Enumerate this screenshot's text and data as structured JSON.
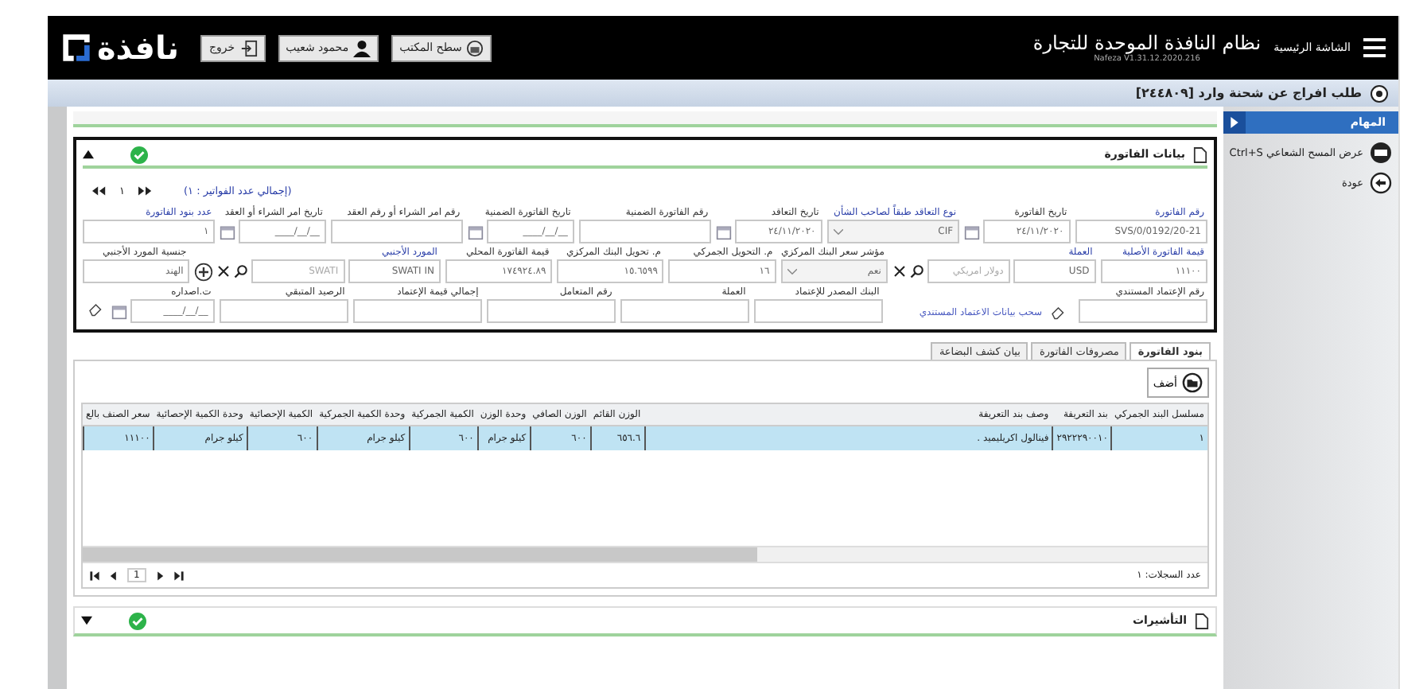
{
  "header": {
    "menu_label": "الشاشة الرئيسية",
    "title": "نظام النافذة الموحدة للتجارة",
    "version": "Nafeza V1.31.12.2020.216",
    "buttons": [
      {
        "kind": "desktop",
        "label": "سطح المكتب"
      },
      {
        "kind": "user",
        "label": "محمود شعيب"
      },
      {
        "kind": "logout",
        "label": "خروج"
      }
    ],
    "logo": "نافذة"
  },
  "page_title": "طلب افراج عن شحنة وارد [٢٤٤٨٠٩]",
  "tasks": {
    "title": "المهام",
    "items": [
      {
        "kind": "scan",
        "label": "عرض المسح الشعاعي Ctrl+S"
      },
      {
        "kind": "back",
        "label": "عودة"
      }
    ]
  },
  "invoice": {
    "title": "بيانات الفاتورة",
    "pager": {
      "page": "١",
      "total": "(إجمالي عدد الفواتير : ١)"
    },
    "rows": [
      [
        {
          "label": "رقم الفاتورة",
          "required": true,
          "kind": "text",
          "value": "SVS/0/0192/20-21"
        },
        {
          "label": "تاريخ الفاتورة",
          "required": false,
          "kind": "date",
          "value": "٢٤/١١/٢٠٢٠"
        },
        {
          "label": "نوع التعاقد طبقاً لصاحب الشأن",
          "required": true,
          "kind": "select",
          "value": "CIF"
        },
        {
          "label": "تاريخ التعاقد",
          "required": false,
          "kind": "date",
          "value": "٢٤/١١/٢٠٢٠"
        },
        {
          "label": "رقم الفاتورة الضمنية",
          "required": false,
          "kind": "text"
        },
        {
          "label": "تاريخ الفاتورة الضمنية",
          "required": false,
          "kind": "date",
          "value": "__/__/____"
        },
        {
          "label": "رقم امر الشراء أو رقم العقد",
          "required": false,
          "kind": "text"
        },
        {
          "label": "تاريخ امر الشراء أو العقد",
          "required": false,
          "kind": "date",
          "value": "__/__/____"
        },
        {
          "label": "عدد بنود الفاتورة",
          "required": true,
          "kind": "text",
          "value": "١"
        }
      ],
      [
        {
          "label": "قيمة الفاتورة الأصلية",
          "required": true,
          "kind": "text",
          "value": "١١١٠٠"
        },
        {
          "label": "العملة",
          "required": true,
          "kind": "lookup",
          "value": "USD",
          "description": "دولار امريكي"
        },
        {
          "label": "مؤشر سعر البنك المركزي",
          "required": false,
          "kind": "select",
          "value": "نعم"
        },
        {
          "label": "م. التحويل الجمركي",
          "required": false,
          "kind": "text",
          "value": "١٦"
        },
        {
          "label": "م. تحويل البنك المركزي",
          "required": false,
          "kind": "text",
          "value": "١٥.٦٥٩٩"
        },
        {
          "label": "قيمة الفاتورة المحلي",
          "required": false,
          "kind": "text",
          "value": "١٧٤٩٢٤.٨٩"
        },
        {
          "label": "المورد الأجنبي",
          "required": true,
          "kind": "lookup-add",
          "value": "SWATI IN",
          "description": "SWATI"
        },
        {
          "label": "جنسية المورد الأجنبي",
          "required": false,
          "kind": "text",
          "value": "الهند"
        }
      ],
      [
        {
          "label": "رقم الإعتماد المستندي",
          "required": false,
          "kind": "text"
        },
        {
          "kind": "link",
          "label": "سحب بيانات الاعتماد المستندي"
        },
        {
          "label": "البنك المصدر للإعتماد",
          "required": false,
          "kind": "text"
        },
        {
          "label": "العملة",
          "required": false,
          "kind": "text"
        },
        {
          "label": "رقم المتعامل",
          "required": false,
          "kind": "text"
        },
        {
          "label": "إجمالي قيمة الإعتماد",
          "required": false,
          "kind": "text"
        },
        {
          "label": "الرصيد المتبقي",
          "required": false,
          "kind": "text"
        },
        {
          "label": "ت.اصداره",
          "required": false,
          "kind": "date",
          "value": "__/__/____"
        },
        {
          "kind": "clear"
        }
      ]
    ]
  },
  "tabs": [
    {
      "label": "بنود الفاتورة",
      "selected": true
    },
    {
      "label": "مصروفات الفاتورة",
      "selected": false
    },
    {
      "label": "بيان كشف البضاعة",
      "selected": false
    }
  ],
  "add_button": "أضف",
  "table": {
    "columns": [
      "مسلسل البند الجمركي",
      "بند التعريفة",
      "وصف بند التعريفة",
      "الوزن القائم",
      "الوزن الصافي",
      "وحدة الوزن",
      "الكمية الجمركية",
      "وحدة الكمية الجمركية",
      "الكمية الإحصائية",
      "وحدة الكمية الإحصائية",
      "سعر الصنف بالع"
    ],
    "rows": [
      {
        "selected": true,
        "cells": [
          "١",
          "٢٩٢٢٢٩٠٠١٠",
          "فينالول اكريليميد .",
          "٦٥٦.٦",
          "٦٠٠",
          "كيلو جرام",
          "٦٠٠",
          "كيلو جرام",
          "٦٠٠",
          "كيلو جرام",
          "١١١٠٠"
        ]
      }
    ],
    "page": "1",
    "record_count": "عدد السجلات: ١"
  },
  "visas": {
    "title": "التأشيرات"
  }
}
